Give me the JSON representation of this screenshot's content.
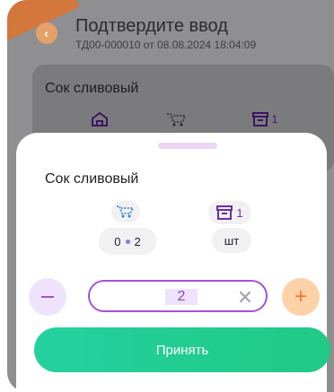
{
  "header": {
    "title": "Подтвердите ввод",
    "subtitle": "ТД00-000010 от 08.08.2024 18:04:09"
  },
  "background_card": {
    "product_name": "Сок сливовый",
    "box_count": "1"
  },
  "sheet": {
    "product_name": "Сок сливовый",
    "stock_left": "0",
    "stock_right": "2",
    "box_count": "1",
    "unit": "шт"
  },
  "quantity": {
    "value": "2"
  },
  "buttons": {
    "accept_label": "Принять",
    "minus_icon": "minus-icon",
    "plus_icon": "plus-icon",
    "clear_icon": "close-icon",
    "back_icon": "chevron-left-icon"
  },
  "colors": {
    "accent_purple": "#9f54d9",
    "accent_orange": "#f07a21",
    "accent_green": "#21c986"
  }
}
